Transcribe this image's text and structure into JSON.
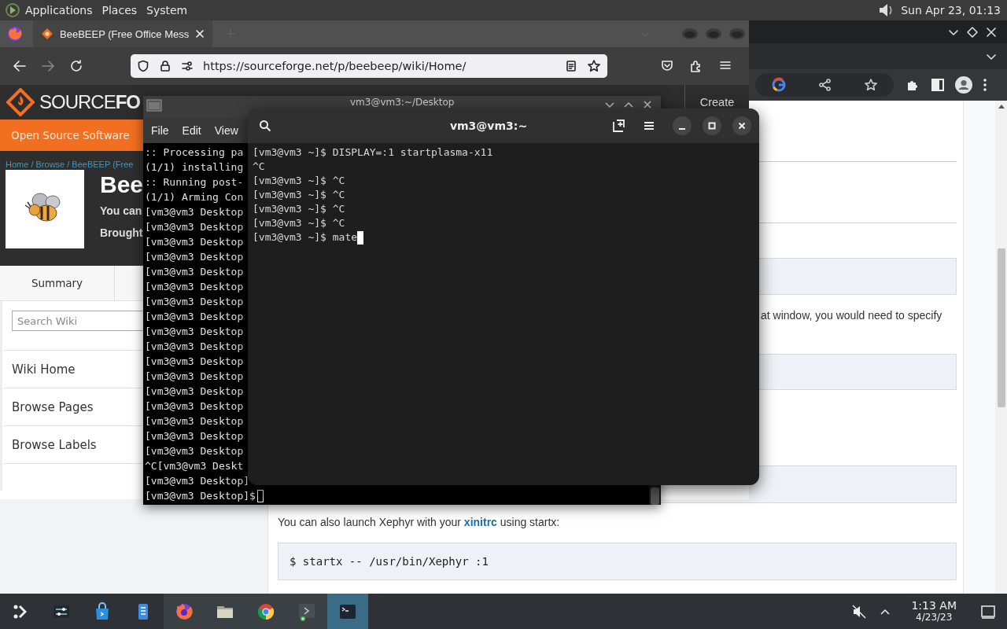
{
  "top_panel": {
    "menus": [
      "Applications",
      "Places",
      "System"
    ],
    "clock": "Sun Apr 23, 01:13"
  },
  "chrome": {
    "page": {
      "paragraph": "at window, you would need to specify",
      "launch": {
        "before": "You can also launch Xephyr with your ",
        "link": "xinitrc",
        "after": " using startx:"
      },
      "code": "$ startx -- /usr/bin/Xephyr :1"
    }
  },
  "firefox": {
    "tab": {
      "title": "BeeBEEP (Free Office Mess",
      "selected": true
    },
    "forward_disabled": true,
    "url": "https://sourceforge.net/p/beebeep/wiki/Home/",
    "page": {
      "logo": "SOURCE**FO**",
      "create": "Create",
      "nav": "Open Source Software",
      "breadcrumb": "Home / Browse / BeeBEEP (Free",
      "title": "Bee",
      "tagline": "You can",
      "byline": "Brought",
      "tabs": [
        "Summary"
      ],
      "search_placeholder": "Search Wiki",
      "sidebar": [
        "Wiki Home",
        "Browse Pages",
        "Browse Labels"
      ]
    }
  },
  "mate_terminal": {
    "title": "vm3@vm3:~/Desktop",
    "menus": [
      "File",
      "Edit",
      "View"
    ],
    "lines": [
      ":: Processing pa",
      "(1/1) installing",
      ":: Running post-",
      "(1/1) Arming Con",
      "[vm3@vm3 Desktop",
      "[vm3@vm3 Desktop",
      "[vm3@vm3 Desktop",
      "[vm3@vm3 Desktop",
      "[vm3@vm3 Desktop",
      "[vm3@vm3 Desktop",
      "[vm3@vm3 Desktop",
      "[vm3@vm3 Desktop",
      "[vm3@vm3 Desktop",
      "[vm3@vm3 Desktop",
      "[vm3@vm3 Desktop",
      "[vm3@vm3 Desktop",
      "[vm3@vm3 Desktop",
      "[vm3@vm3 Desktop",
      "[vm3@vm3 Desktop",
      "[vm3@vm3 Desktop",
      "[vm3@vm3 Desktop",
      "^C[vm3@vm3 Deskt",
      "[vm3@vm3 Desktop]",
      "[vm3@vm3 Desktop]$"
    ]
  },
  "gnome_terminal": {
    "title": "vm3@vm3:~",
    "lines": [
      "[vm3@vm3 ~]$ DISPLAY=:1 startplasma-x11",
      "^C",
      "[vm3@vm3 ~]$ ^C",
      "[vm3@vm3 ~]$ ^C",
      "[vm3@vm3 ~]$ ^C",
      "[vm3@vm3 ~]$ ^C",
      "[vm3@vm3 ~]$ mate"
    ]
  },
  "taskbar": {
    "items": [
      {
        "running": false,
        "active": false
      },
      {
        "running": false,
        "active": false
      },
      {
        "running": false,
        "active": false
      },
      {
        "running": false,
        "active": false
      },
      {
        "running": true,
        "active": false
      },
      {
        "running": true,
        "active": false
      },
      {
        "running": true,
        "active": false
      },
      {
        "running": true,
        "active": false
      },
      {
        "running": true,
        "active": true
      }
    ],
    "time": "1:13 AM",
    "date": "4/23/23"
  }
}
